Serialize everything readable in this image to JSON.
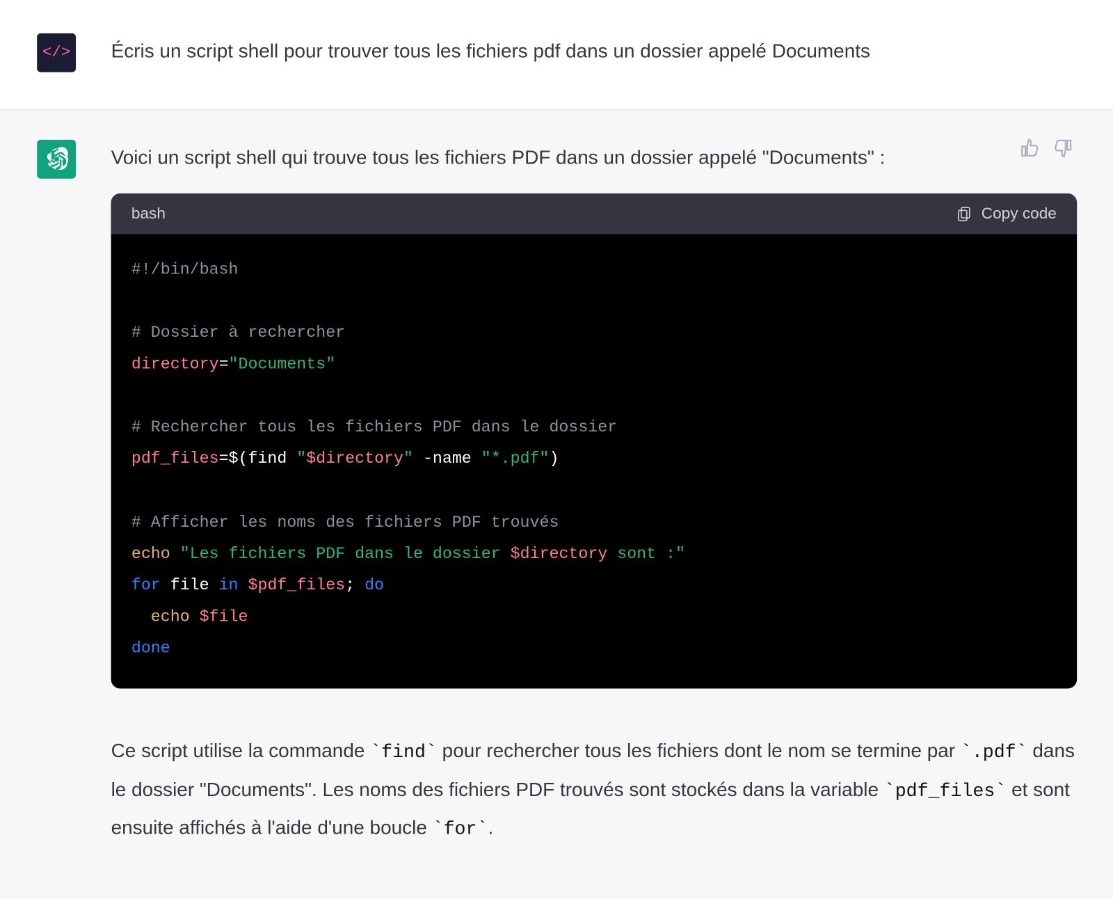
{
  "user": {
    "avatar_text": "</>",
    "message": "Écris un script shell pour trouver tous les fichiers pdf dans un dossier appelé Documents"
  },
  "assistant": {
    "intro": "Voici un script shell qui trouve tous les fichiers PDF dans un dossier appelé \"Documents\" :",
    "codeblock": {
      "language": "bash",
      "copy_label": "Copy code",
      "code": {
        "l1_plain_shebang": "#!/bin/bash",
        "l2_comment": "# Dossier à rechercher",
        "l3_var": "directory",
        "l3_eq": "=",
        "l3_str": "\"Documents\"",
        "l4_comment": "# Rechercher tous les fichiers PDF dans le dossier",
        "l5_var": "pdf_files",
        "l5_eq": "=$(find ",
        "l5_str1_open": "\"",
        "l5_str1_var": "$directory",
        "l5_str1_close": "\"",
        "l5_mid": " -name ",
        "l5_str2": "\"*.pdf\"",
        "l5_end": ")",
        "l6_comment": "# Afficher les noms des fichiers PDF trouvés",
        "l7_echo": "echo",
        "l7_sp": " ",
        "l7_str_open": "\"Les fichiers PDF dans le dossier ",
        "l7_str_var": "$directory",
        "l7_str_close": " sont :\"",
        "l8_for": "for",
        "l8_file": " file ",
        "l8_in": "in",
        "l8_var": " $pdf_files",
        "l8_semi": "; ",
        "l8_do": "do",
        "l9_indent": "  ",
        "l9_echo": "echo",
        "l9_sp": " ",
        "l9_var": "$file",
        "l10_done": "done"
      }
    },
    "explanation": {
      "p1a": "Ce script utilise la commande ",
      "c1": "`find`",
      "p1b": " pour rechercher tous les fichiers dont le nom se termine par ",
      "c2": "`.pdf`",
      "p1c": " dans le dossier \"Documents\". Les noms des fichiers PDF trouvés sont stockés dans la variable ",
      "c3": "`pdf_files`",
      "p1d": " et sont ensuite affichés à l'aide d'une boucle ",
      "c4": "`for`",
      "p1e": "."
    }
  }
}
